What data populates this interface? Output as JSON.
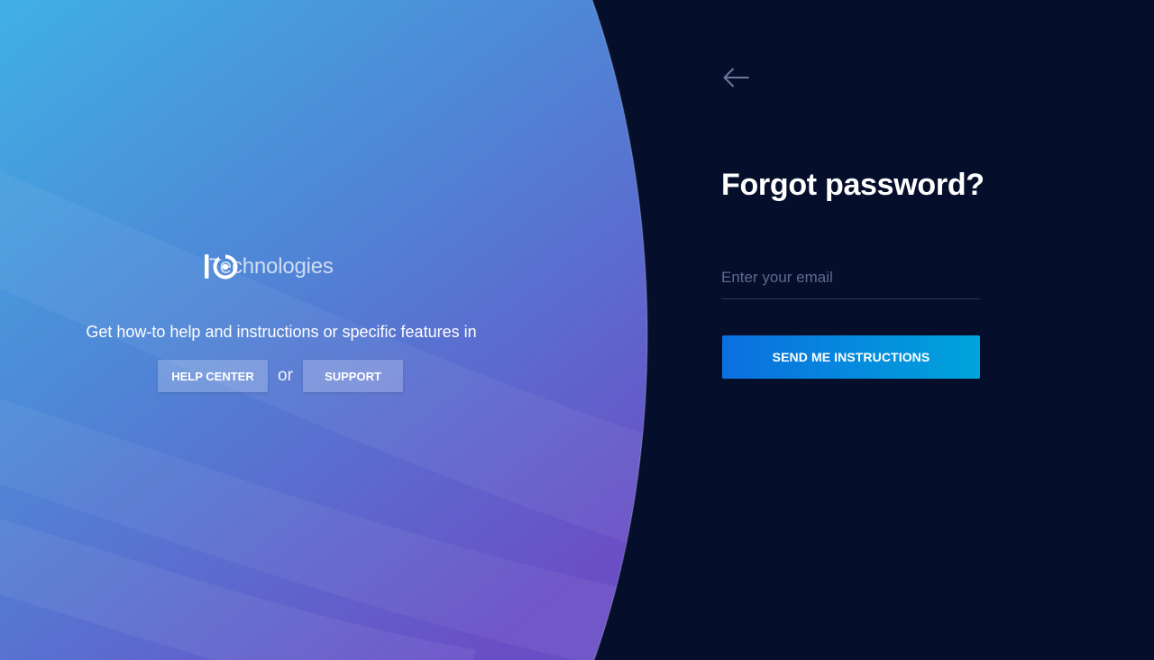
{
  "brand": {
    "name": "Technologies",
    "logo_icon": "io-logo-icon"
  },
  "help": {
    "text": "Get how-to help and instructions or specific features in",
    "help_center_label": "HELP CENTER",
    "or_label": "or",
    "support_label": "SUPPORT"
  },
  "form": {
    "back_icon": "arrow-left-icon",
    "title": "Forgot password?",
    "email_placeholder": "Enter your email",
    "email_value": "",
    "submit_label": "SEND ME INSTRUCTIONS"
  },
  "colors": {
    "background": "#050f2c",
    "gradient_top": "#41ade3",
    "gradient_bottom": "#6a4fc6",
    "button_start": "#0a6fdf",
    "button_end": "#00a4dc"
  }
}
